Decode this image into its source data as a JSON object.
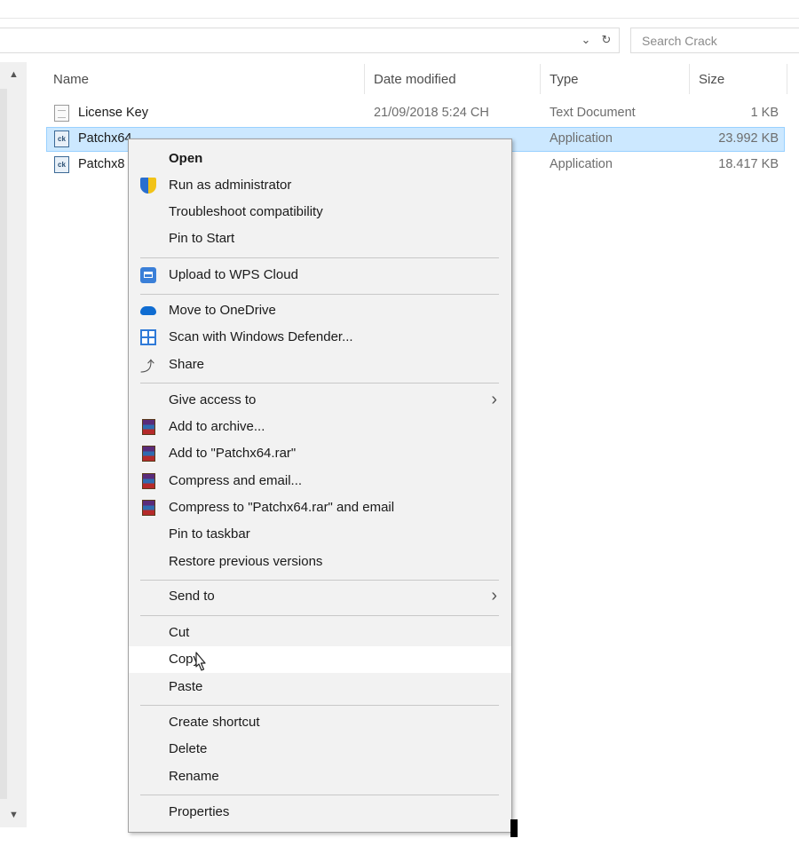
{
  "search": {
    "placeholder": "Search Crack"
  },
  "columns": {
    "name": "Name",
    "date": "Date modified",
    "type": "Type",
    "size": "Size"
  },
  "files": [
    {
      "name": "License Key",
      "date": "21/09/2018 5:24 CH",
      "type": "Text Document",
      "size": "1 KB"
    },
    {
      "name": "Patchx64",
      "date": "",
      "type": "Application",
      "size": "23.992 KB"
    },
    {
      "name": "Patchx8",
      "date": "",
      "type": "Application",
      "size": "18.417 KB"
    }
  ],
  "menu": {
    "open": "Open",
    "run_admin": "Run as administrator",
    "troubleshoot": "Troubleshoot compatibility",
    "pin_start": "Pin to Start",
    "upload_wps": "Upload to WPS Cloud",
    "move_onedrive": "Move to OneDrive",
    "scan_defender": "Scan with Windows Defender...",
    "share": "Share",
    "give_access": "Give access to",
    "add_archive": "Add to archive...",
    "add_rar": "Add to \"Patchx64.rar\"",
    "compress_email": "Compress and email...",
    "compress_rar_email": "Compress to \"Patchx64.rar\" and email",
    "pin_taskbar": "Pin to taskbar",
    "restore": "Restore previous versions",
    "send_to": "Send to",
    "cut": "Cut",
    "copy": "Copy",
    "paste": "Paste",
    "create_shortcut": "Create shortcut",
    "delete": "Delete",
    "rename": "Rename",
    "properties": "Properties"
  },
  "colors": {
    "selection": "#cce8ff",
    "selection_border": "#99d1ff",
    "menu_bg": "#f2f2f2",
    "hover": "#ffffff"
  }
}
